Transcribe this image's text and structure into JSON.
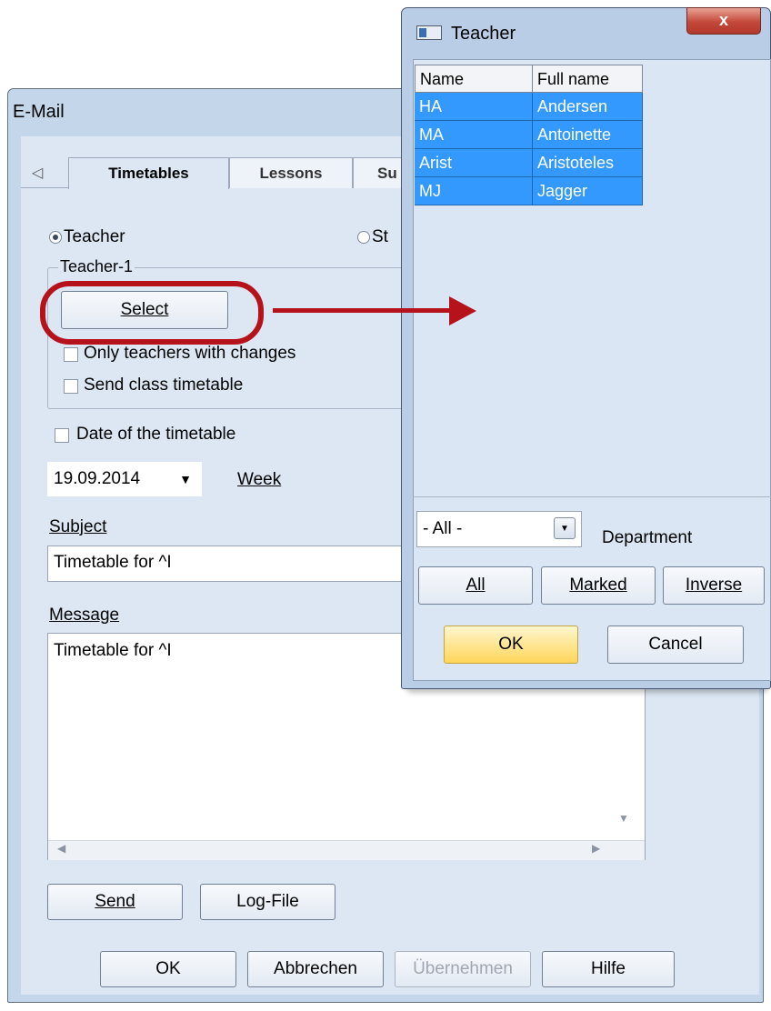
{
  "email_dialog": {
    "title": "E-Mail",
    "tabs": [
      {
        "label": "Timetables",
        "active": true
      },
      {
        "label": "Lessons",
        "active": false
      },
      {
        "label": "Su",
        "active": false
      }
    ],
    "recipient_options": [
      {
        "label": "Teacher",
        "selected": true
      },
      {
        "label": "St",
        "selected": false
      }
    ],
    "group_title": "Teacher-1",
    "select_button": "Select",
    "checkboxes": {
      "only_teachers_with_changes": {
        "label": "Only teachers with changes",
        "checked": false
      },
      "send_class_timetable": {
        "label": "Send class timetable",
        "checked": false
      },
      "date_of_timetable": {
        "label": "Date of the timetable",
        "checked": false
      }
    },
    "date_value": "19.09.2014",
    "week_label": "Week",
    "subject_label": "Subject",
    "subject_value": "Timetable for ^I",
    "message_label": "Message",
    "message_value": "Timetable for ^I",
    "send_button": "Send",
    "logfile_button": "Log-File",
    "footer_buttons": {
      "ok": "OK",
      "cancel": "Abbrechen",
      "apply": "Übernehmen",
      "help": "Hilfe"
    }
  },
  "teacher_dialog": {
    "title": "Teacher",
    "close_glyph": "x",
    "columns": [
      "Name",
      "Full name"
    ],
    "rows": [
      {
        "name": "HA",
        "full_name": "Andersen"
      },
      {
        "name": "MA",
        "full_name": "Antoinette"
      },
      {
        "name": "Arist",
        "full_name": "Aristoteles"
      },
      {
        "name": "MJ",
        "full_name": "Jagger"
      }
    ],
    "department_value": "- All -",
    "department_label": "Department",
    "buttons": {
      "all": "All",
      "marked": "Marked",
      "inverse": "Inverse",
      "ok": "OK",
      "cancel": "Cancel"
    }
  },
  "colors": {
    "annotation": "#b5121b",
    "selection": "#3399ff",
    "window_frame": "#c4d6ea",
    "close_button": "#c4483a"
  }
}
